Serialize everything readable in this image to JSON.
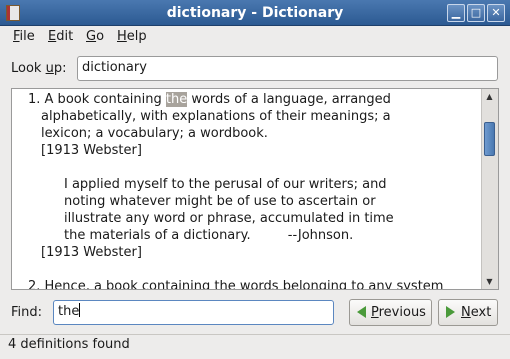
{
  "window": {
    "title": "dictionary - Dictionary",
    "minimize_glyph": "▁",
    "maximize_glyph": "□",
    "close_glyph": "✕"
  },
  "menu": {
    "file": {
      "mnemonic": "F",
      "rest": "ile"
    },
    "edit": {
      "mnemonic": "E",
      "rest": "dit"
    },
    "go": {
      "mnemonic": "G",
      "rest": "o"
    },
    "help": {
      "mnemonic": "H",
      "rest": "elp"
    }
  },
  "lookup": {
    "label_pre": "Look ",
    "label_mnemonic": "u",
    "label_post": "p:",
    "value": "dictionary"
  },
  "definition": {
    "l1_pre": "1. A book containing ",
    "l1_hl": "the",
    "l1_post": " words of a language, arranged",
    "l2": "alphabetically, with explanations of their meanings; a",
    "l3": "lexicon; a vocabulary; a wordbook.",
    "l4": "[1913 Webster]",
    "l5": "I applied myself to the perusal of our writers; and",
    "l6": "noting whatever might be of use to ascertain or",
    "l7": "illustrate any word or phrase, accumulated in time",
    "l8": "the materials of a dictionary.         --Johnson.",
    "l9": "[1913 Webster]",
    "l10": "2. Hence, a book containing the words belonging to any system"
  },
  "find": {
    "label": "Find:",
    "value": "the",
    "previous_mnemonic": "P",
    "previous_rest": "revious",
    "next_mnemonic": "N",
    "next_rest": "ext"
  },
  "status": {
    "text": "4 definitions found"
  },
  "colors": {
    "titlebar": "#2c5a92",
    "highlight": "#a8a39c",
    "arrow_green": "#4a9a3a"
  },
  "icons": {
    "app": "dictionary-book-icon",
    "previous": "arrow-left-icon",
    "next": "arrow-right-icon",
    "scroll_up": "scroll-up-arrow-icon",
    "scroll_down": "scroll-down-arrow-icon"
  }
}
